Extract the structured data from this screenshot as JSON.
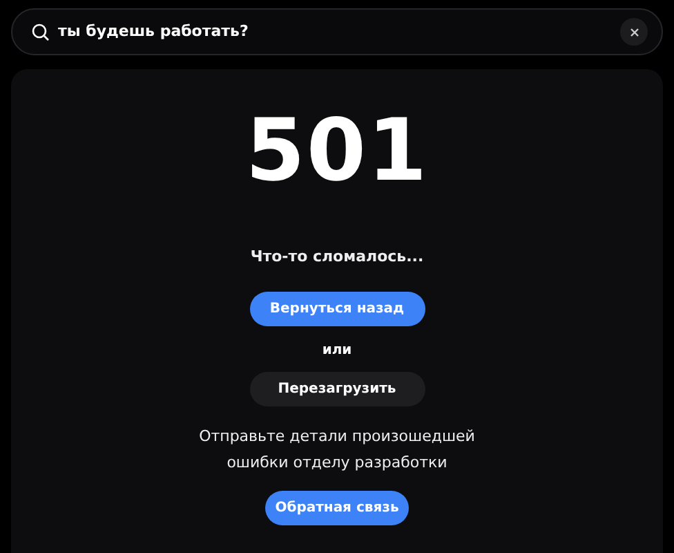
{
  "search": {
    "value": "ты будешь работать?"
  },
  "error": {
    "code": "501",
    "message": "Что-то сломалось...",
    "back_button": "Вернуться назад",
    "separator": "или",
    "reload_button": "Перезагрузить",
    "report_text": "Отправьте детали произошедшей ошибки отделу разработки",
    "feedback_button": "Обратная связь"
  }
}
